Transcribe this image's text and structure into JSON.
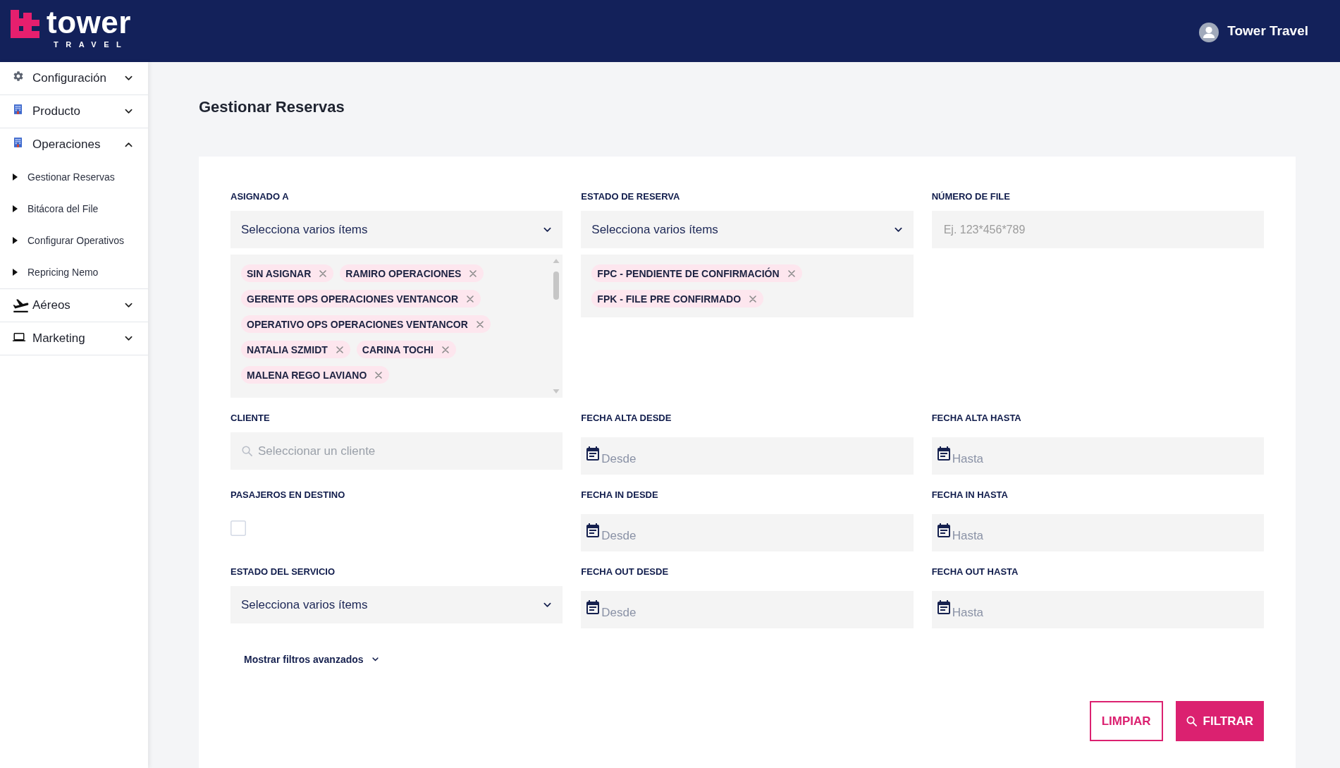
{
  "header": {
    "logo": {
      "wordmark": "tower",
      "tagline": "TRAVEL"
    },
    "user": {
      "name": "Tower Travel"
    }
  },
  "sidebar": {
    "items": [
      {
        "label": "Configuración",
        "expanded": false
      },
      {
        "label": "Producto",
        "expanded": false
      },
      {
        "label": "Operaciones",
        "expanded": true,
        "children": [
          {
            "label": "Gestionar Reservas"
          },
          {
            "label": "Bitácora del File"
          },
          {
            "label": "Configurar Operativos"
          },
          {
            "label": "Repricing Nemo"
          }
        ]
      },
      {
        "label": "Aéreos",
        "expanded": false
      },
      {
        "label": "Marketing",
        "expanded": false
      }
    ]
  },
  "page": {
    "title": "Gestionar Reservas"
  },
  "filters": [
    {
      "kind": "multiselect",
      "label": "ASIGNADO A",
      "prompt": "Selecciona varios ítems",
      "scrollable": true,
      "tags": [
        "SIN ASIGNAR",
        "RAMIRO OPERACIONES",
        "GERENTE OPS OPERACIONES VENTANCOR",
        "OPERATIVO OPS OPERACIONES VENTANCOR",
        "NATALIA SZMIDT",
        "CARINA TOCHI",
        "MALENA REGO LAVIANO"
      ]
    },
    {
      "kind": "multiselect",
      "label": "ESTADO DE RESERVA",
      "prompt": "Selecciona varios ítems",
      "scrollable": false,
      "tags": [
        "FPC - PENDIENTE DE CONFIRMACIÓN",
        "FPK - FILE PRE CONFIRMADO"
      ]
    },
    {
      "kind": "text",
      "label": "NÚMERO DE FILE",
      "placeholder": "Ej. 123*456*789"
    },
    {
      "kind": "search",
      "label": "CLIENTE",
      "placeholder": "Seleccionar un cliente"
    },
    {
      "kind": "date",
      "label": "FECHA ALTA DESDE",
      "placeholder": "Desde"
    },
    {
      "kind": "date",
      "label": "FECHA ALTA HASTA",
      "placeholder": "Hasta"
    },
    {
      "kind": "checkbox",
      "label": "PASAJEROS EN DESTINO",
      "checked": false
    },
    {
      "kind": "date",
      "label": "FECHA IN DESDE",
      "placeholder": "Desde"
    },
    {
      "kind": "date",
      "label": "FECHA IN HASTA",
      "placeholder": "Hasta"
    },
    {
      "kind": "multiselect",
      "label": "ESTADO DEL SERVICIO",
      "prompt": "Selecciona varios ítems"
    },
    {
      "kind": "date",
      "label": "FECHA OUT DESDE",
      "placeholder": "Desde"
    },
    {
      "kind": "date",
      "label": "FECHA OUT HASTA",
      "placeholder": "Hasta"
    }
  ],
  "advanced_filters": {
    "label": "Mostrar filtros avanzados",
    "expanded": false
  },
  "actions": [
    {
      "kind": "outline",
      "label": "LIMPIAR"
    },
    {
      "kind": "primary",
      "label": "FILTRAR"
    }
  ]
}
